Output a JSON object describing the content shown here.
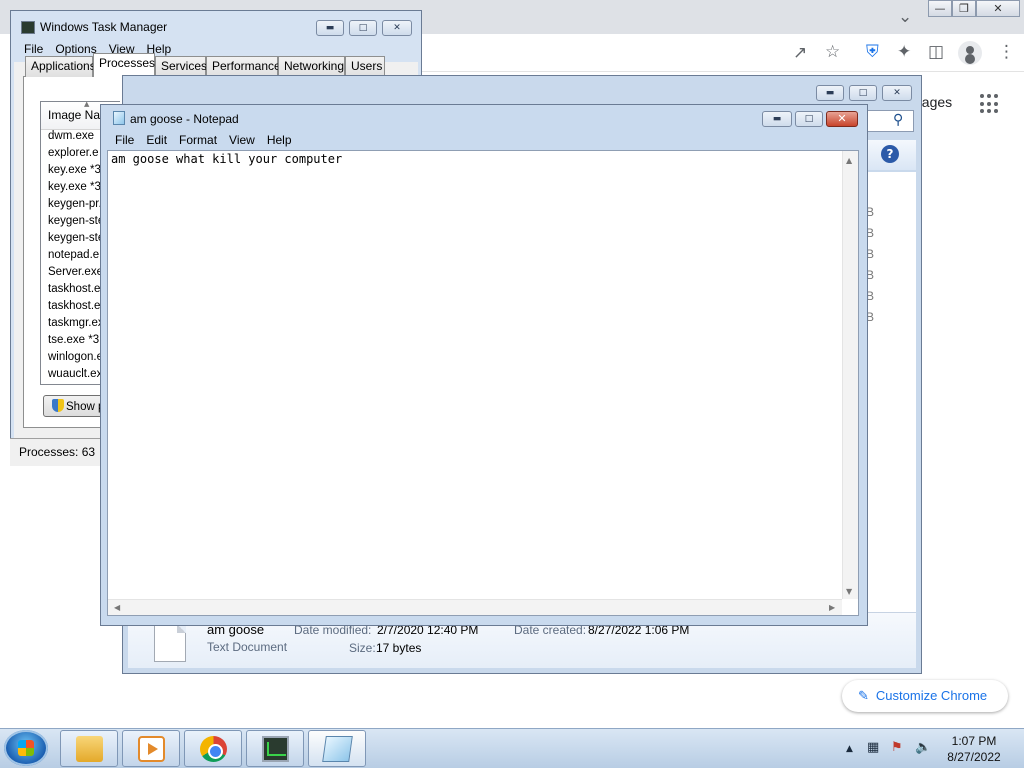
{
  "chrome": {
    "images_link": "nages",
    "customize_label": "Customize Chrome"
  },
  "task_manager": {
    "title": "Windows Task Manager",
    "menu": [
      "File",
      "Options",
      "View",
      "Help"
    ],
    "tabs": [
      "Applications",
      "Processes",
      "Services",
      "Performance",
      "Networking",
      "Users"
    ],
    "column_header": "Image Nam",
    "processes": [
      "dwm.exe",
      "explorer.e",
      "key.exe *3",
      "key.exe *3",
      "keygen-pr.",
      "keygen-ste",
      "keygen-ste",
      "notepad.e",
      "Server.exe",
      "taskhost.e",
      "taskhost.e",
      "taskmgr.ex",
      "tse.exe *3",
      "winlogon.e",
      "wuauclt.ex"
    ],
    "show_button": "Show p",
    "status": "Processes: 63"
  },
  "explorer": {
    "file_name": "am goose",
    "file_type": "Text Document",
    "date_modified_label": "Date modified:",
    "date_modified_value": "2/7/2020 12:40 PM",
    "date_created_label": "Date created:",
    "date_created_value": "8/27/2022 1:06 PM",
    "size_label": "Size:",
    "size_value": "17 bytes",
    "size_column": [
      "B",
      "B",
      "B",
      "B",
      "B",
      "B"
    ]
  },
  "notepad": {
    "title": "am goose - Notepad",
    "menu": [
      "File",
      "Edit",
      "Format",
      "View",
      "Help"
    ],
    "content": "am goose what kill your computer"
  },
  "taskbar": {
    "time": "1:07 PM",
    "date": "8/27/2022"
  }
}
